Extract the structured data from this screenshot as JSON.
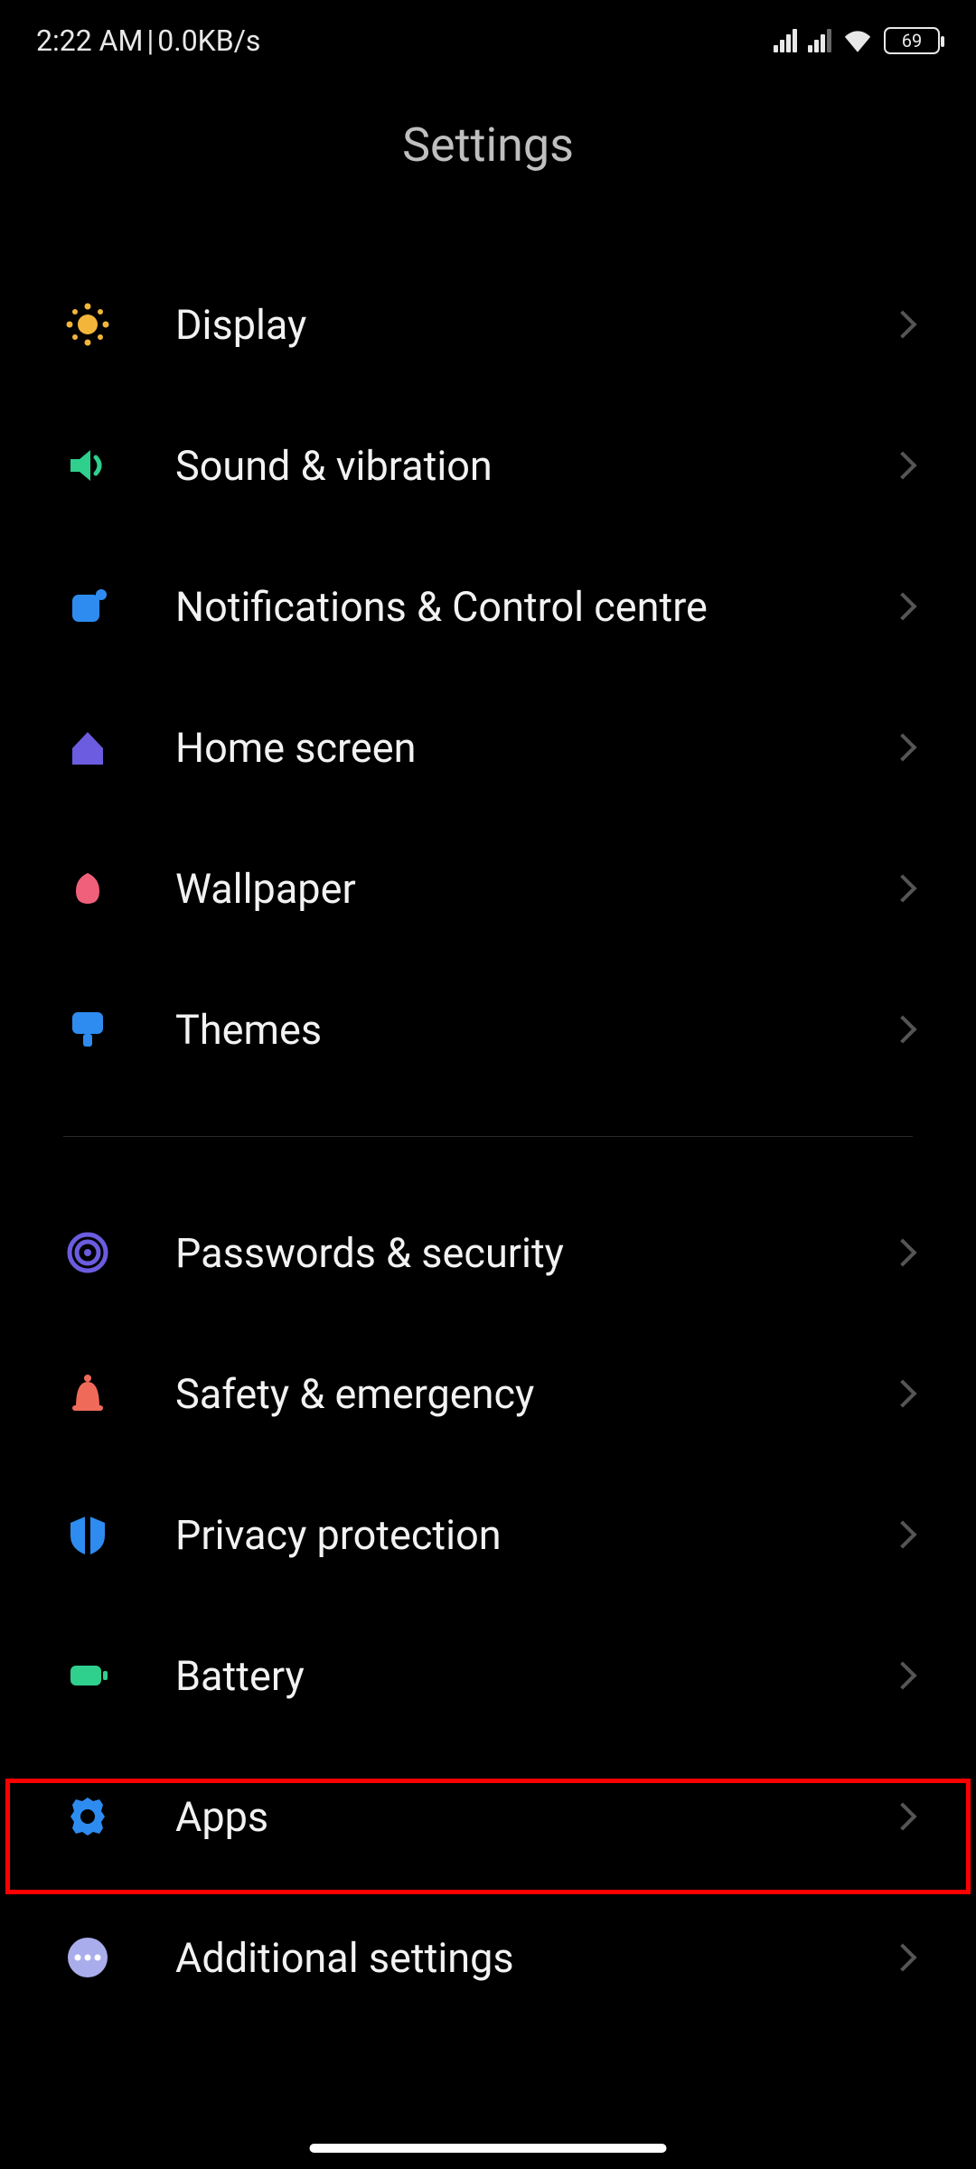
{
  "statusBar": {
    "time": "2:22 AM",
    "separator": " | ",
    "netSpeed": "0.0KB/s",
    "battery": "69"
  },
  "header": {
    "title": "Settings"
  },
  "group1": [
    {
      "id": "display",
      "label": "Display"
    },
    {
      "id": "sound",
      "label": "Sound & vibration"
    },
    {
      "id": "notifications",
      "label": "Notifications & Control centre"
    },
    {
      "id": "home-screen",
      "label": "Home screen"
    },
    {
      "id": "wallpaper",
      "label": "Wallpaper"
    },
    {
      "id": "themes",
      "label": "Themes"
    }
  ],
  "group2": [
    {
      "id": "passwords",
      "label": "Passwords & security"
    },
    {
      "id": "safety",
      "label": "Safety & emergency"
    },
    {
      "id": "privacy",
      "label": "Privacy protection"
    },
    {
      "id": "battery",
      "label": "Battery"
    },
    {
      "id": "apps",
      "label": "Apps"
    },
    {
      "id": "additional",
      "label": "Additional settings"
    }
  ],
  "highlightedItem": "apps"
}
